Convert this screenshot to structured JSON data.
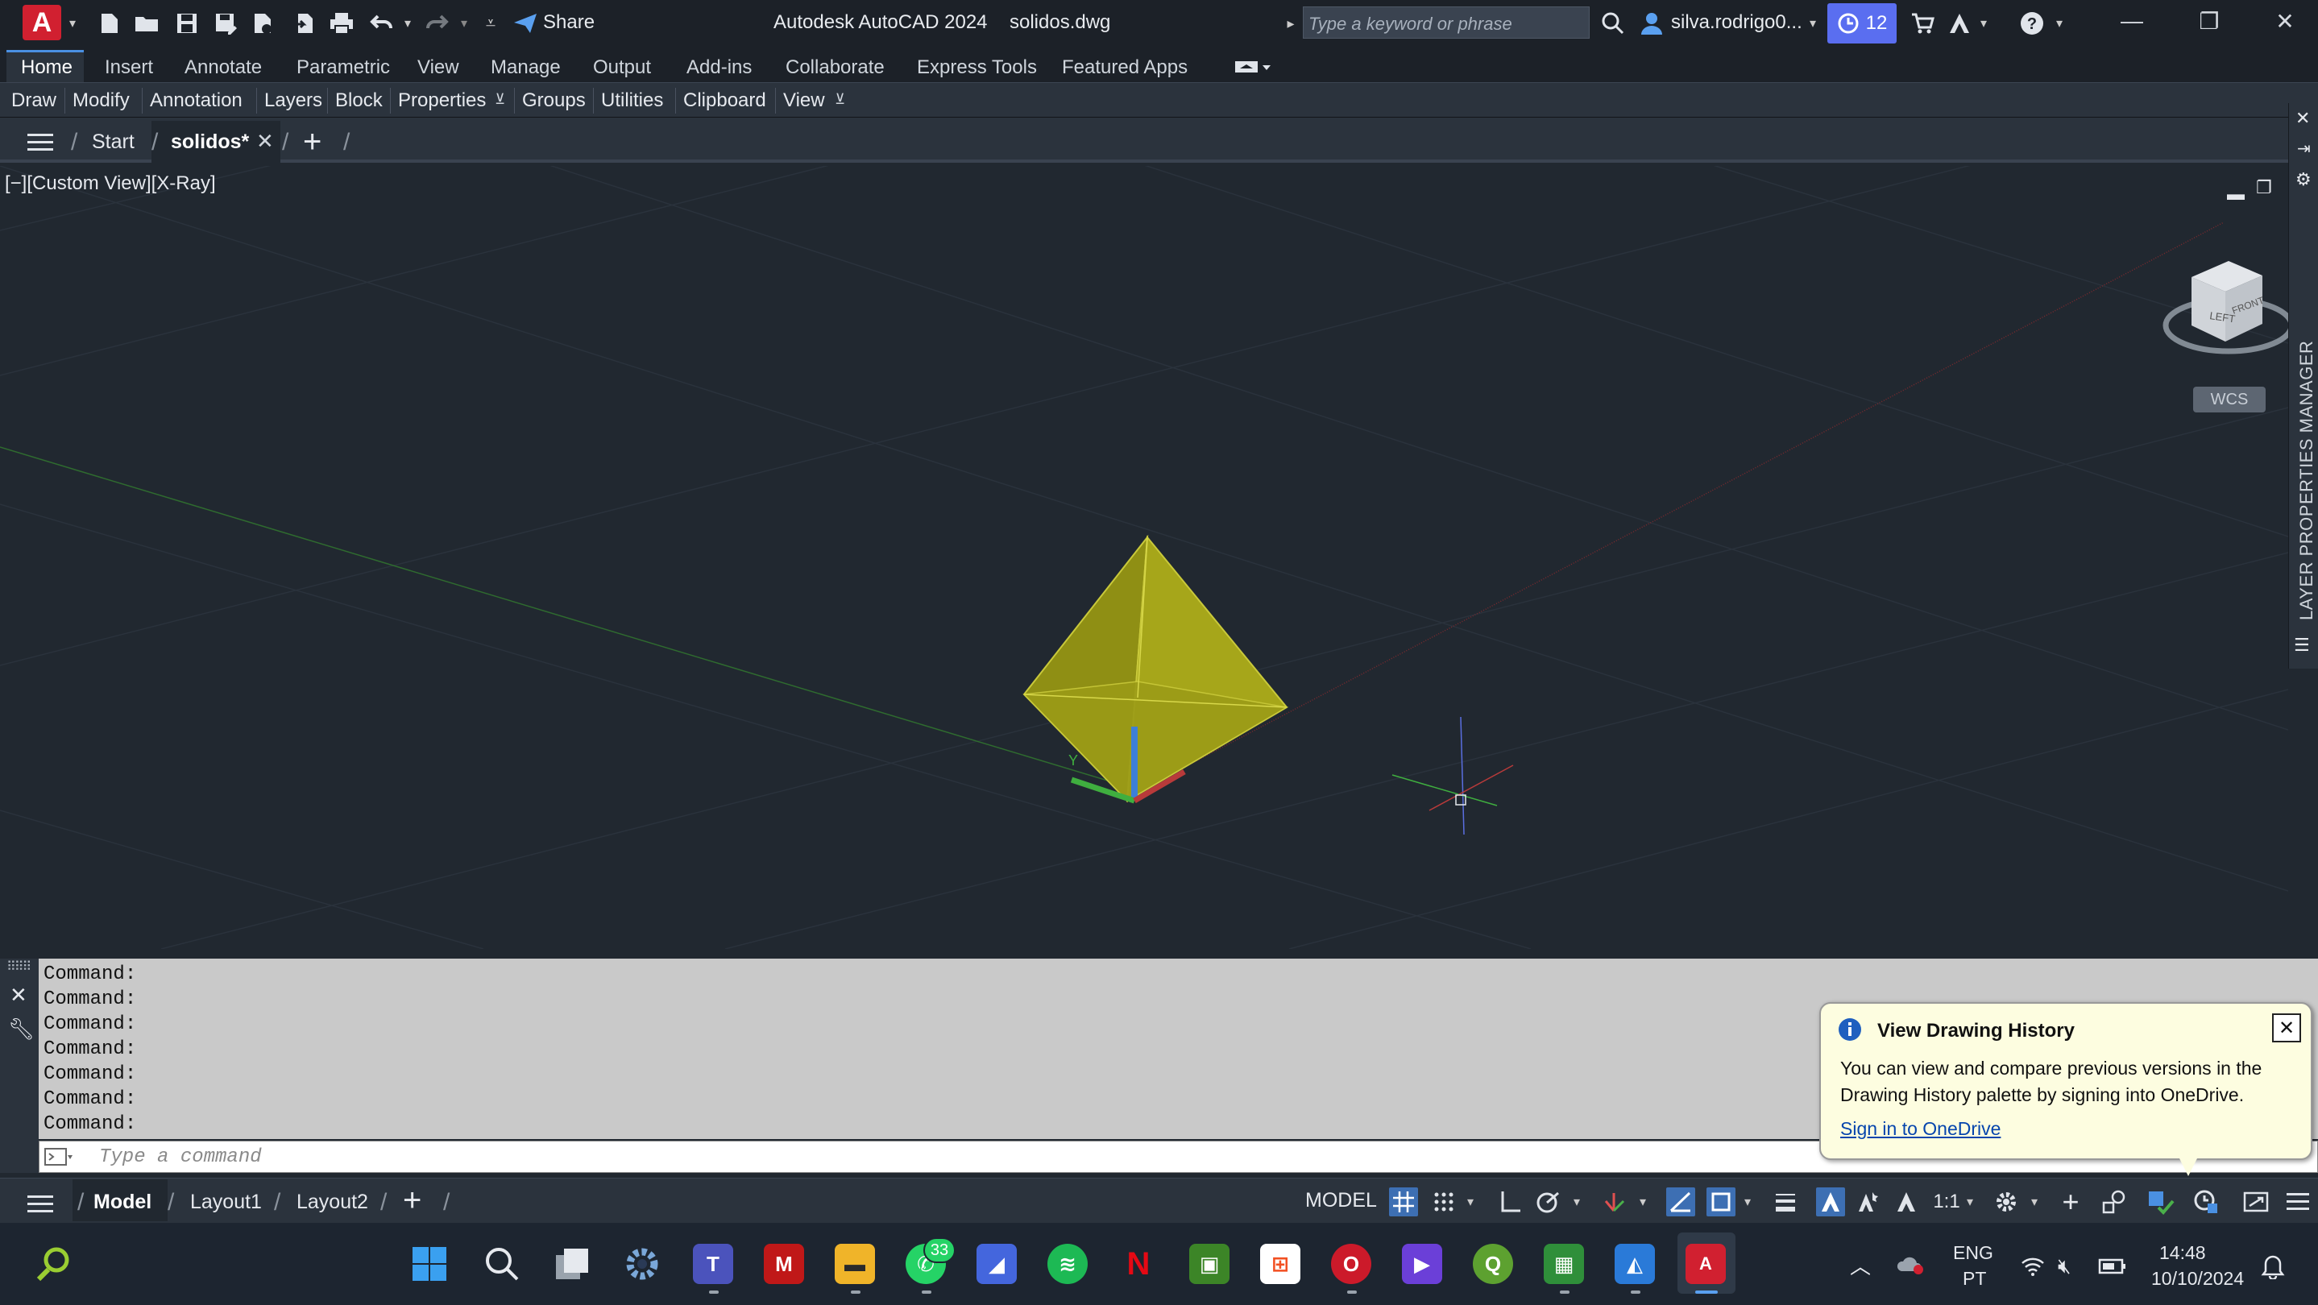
{
  "window": {
    "app_title": "Autodesk AutoCAD 2024",
    "file_name": "solidos.dwg",
    "share_label": "Share",
    "search_placeholder": "Type a keyword or phrase",
    "user_name": "silva.rodrigo0...",
    "notification_count": "12",
    "app_logo_letter": "A"
  },
  "ribbon": {
    "tabs": [
      "Home",
      "Insert",
      "Annotate",
      "Parametric",
      "View",
      "Manage",
      "Output",
      "Add-ins",
      "Collaborate",
      "Express Tools",
      "Featured Apps"
    ],
    "panels": [
      "Draw",
      "Modify",
      "Annotation",
      "Layers",
      "Block",
      "Properties",
      "Groups",
      "Utilities",
      "Clipboard",
      "View"
    ]
  },
  "file_tabs": {
    "start": "Start",
    "active": "solidos*"
  },
  "viewport": {
    "label": "[−][Custom View][X-Ray]",
    "viewcube_left": "LEFT",
    "viewcube_front": "FRONT",
    "wcs": "WCS",
    "side_palette": "LAYER PROPERTIES MANAGER"
  },
  "command_line": {
    "history": [
      "Command:",
      "Command:",
      "Command:",
      "Command:",
      "Command:",
      "Command:",
      "Command:"
    ],
    "input_placeholder": "Type a command"
  },
  "popup": {
    "title": "View Drawing History",
    "body": "You can view and compare previous versions in the Drawing History palette by signing into OneDrive.",
    "link": "Sign in to OneDrive"
  },
  "status_bar": {
    "layout_tabs": [
      "Model",
      "Layout1",
      "Layout2"
    ],
    "model_button": "MODEL",
    "scale": "1:1"
  },
  "taskbar": {
    "whatsapp_badge": "33",
    "language_top": "ENG",
    "language_bottom": "PT",
    "time": "14:48",
    "date": "10/10/2024"
  },
  "colors": {
    "accent": "#4a90e2",
    "solid_fill": "#a6a61a",
    "autocad_red": "#d12030"
  }
}
